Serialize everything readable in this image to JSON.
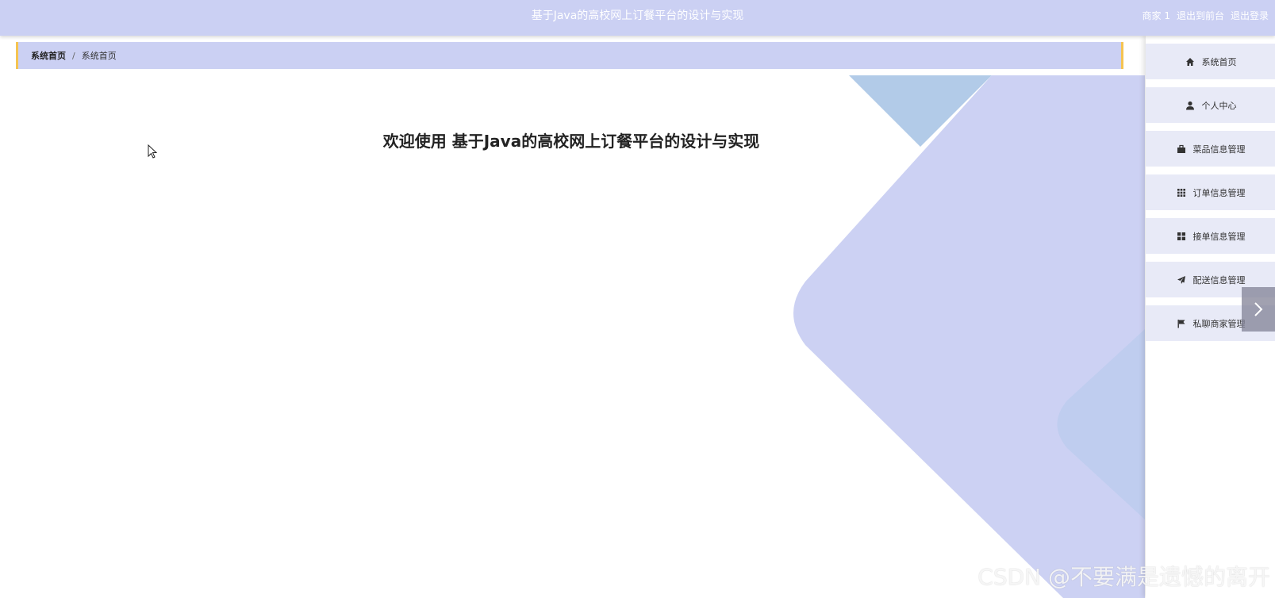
{
  "header": {
    "title": "基于Java的高校网上订餐平台的设计与实现",
    "user": "商家 1",
    "to_front": "退出到前台",
    "logout": "退出登录"
  },
  "breadcrumb": {
    "home": "系统首页",
    "separator": "/",
    "current": "系统首页"
  },
  "main": {
    "welcome": "欢迎使用 基于Java的高校网上订餐平台的设计与实现"
  },
  "sidebar": {
    "items": [
      {
        "label": "系统首页",
        "icon": "home-icon"
      },
      {
        "label": "个人中心",
        "icon": "user-icon"
      },
      {
        "label": "菜品信息管理",
        "icon": "briefcase-icon"
      },
      {
        "label": "订单信息管理",
        "icon": "grid-icon"
      },
      {
        "label": "接单信息管理",
        "icon": "apps-icon"
      },
      {
        "label": "配送信息管理",
        "icon": "paper-plane-icon"
      },
      {
        "label": "私聊商家管理",
        "icon": "flag-icon"
      }
    ]
  },
  "watermark": "CSDN @不要满是遗憾的离开",
  "colors": {
    "primary": "#cbd0f3",
    "accent": "#f5c451",
    "menu_bg": "#e8eaf7"
  }
}
